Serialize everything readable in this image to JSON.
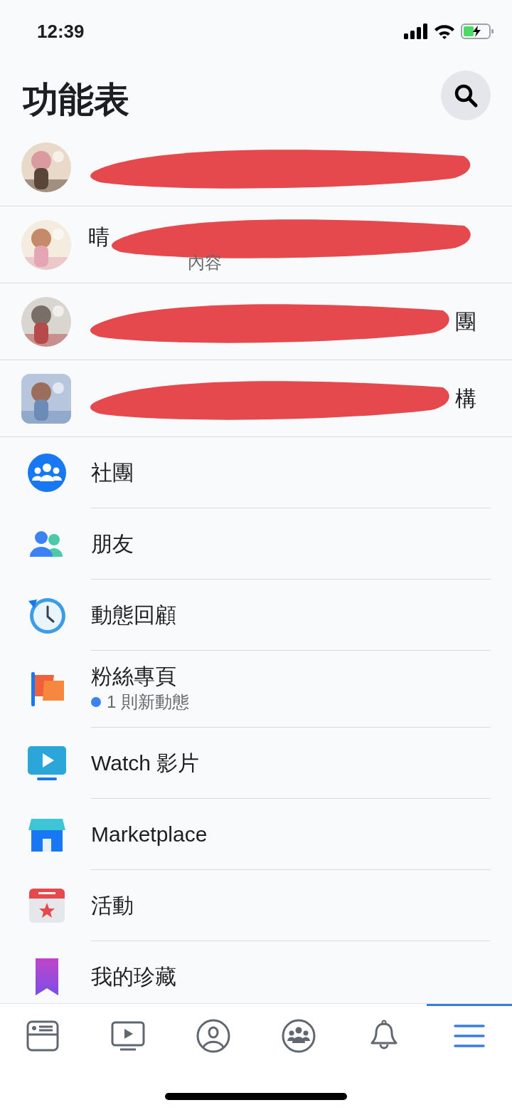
{
  "status_bar": {
    "time": "12:39"
  },
  "header": {
    "title": "功能表"
  },
  "pages": [
    {
      "kind": "redacted"
    },
    {
      "kind": "redacted",
      "before": "晴",
      "subtitle": "內容"
    },
    {
      "kind": "redacted",
      "after": "團"
    },
    {
      "kind": "redacted",
      "after": "構"
    }
  ],
  "menu": [
    {
      "kind": "groups",
      "label": "社團"
    },
    {
      "kind": "friends",
      "label": "朋友"
    },
    {
      "kind": "memories",
      "label": "動態回顧"
    },
    {
      "kind": "pages",
      "label": "粉絲專頁",
      "subtitle": "1 則新動態"
    },
    {
      "kind": "watch",
      "label": "Watch 影片"
    },
    {
      "kind": "marketplace",
      "label": "Marketplace"
    },
    {
      "kind": "events",
      "label": "活動"
    },
    {
      "kind": "saved",
      "label": "我的珍藏"
    }
  ],
  "tab_bar": [
    {
      "kind": "news",
      "selected": false
    },
    {
      "kind": "video",
      "selected": false
    },
    {
      "kind": "profile",
      "selected": false
    },
    {
      "kind": "groups",
      "selected": false
    },
    {
      "kind": "bell",
      "selected": false
    },
    {
      "kind": "menu",
      "selected": true
    }
  ]
}
